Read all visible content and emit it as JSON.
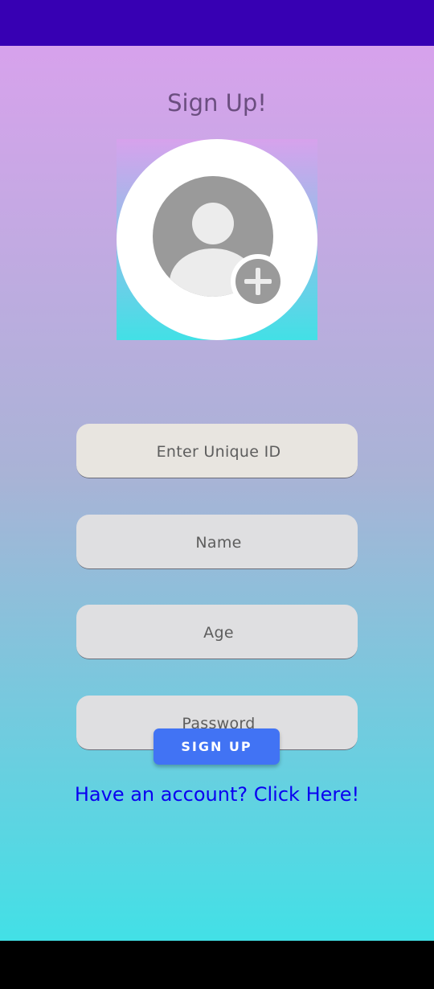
{
  "title": "Sign Up!",
  "avatar": {
    "icon": "account-circle-icon",
    "badge_icon": "add-icon"
  },
  "fields": {
    "unique_id": {
      "placeholder": "Enter Unique ID",
      "value": ""
    },
    "name": {
      "placeholder": "Name",
      "value": ""
    },
    "age": {
      "placeholder": "Age",
      "value": ""
    },
    "password": {
      "placeholder": "Password",
      "value": ""
    }
  },
  "signup_button": {
    "label": "SIGN UP"
  },
  "login_link": {
    "label": "Have an account? Click Here!"
  },
  "colors": {
    "status_bar": "#3700b3",
    "gradient_top": "#d7a2ec",
    "gradient_bottom": "#42e0e6",
    "button": "#4173f4",
    "link": "#0a00f0",
    "title": "#6b4e7f"
  }
}
